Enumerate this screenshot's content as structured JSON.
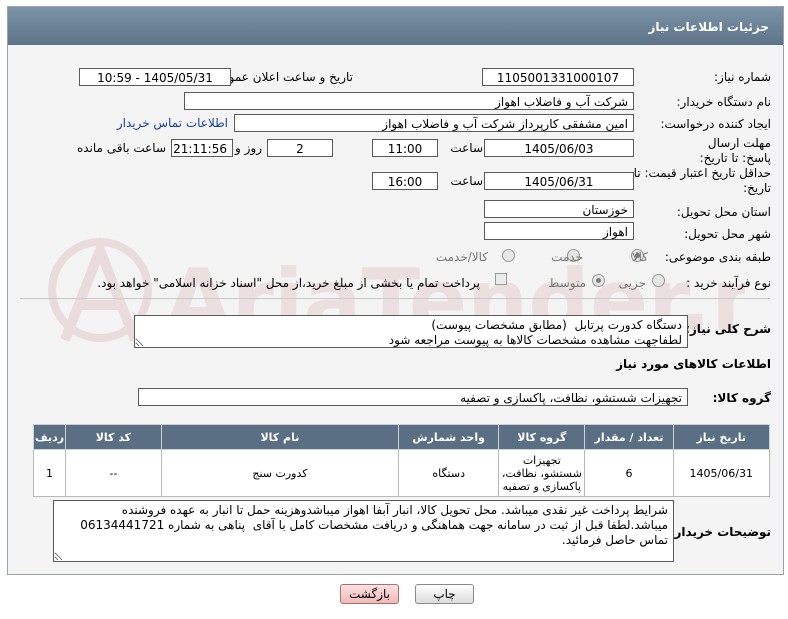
{
  "header": {
    "title": "جزئیات اطلاعات نیاز"
  },
  "fields": {
    "need_number_label": "شماره نیاز:",
    "need_number": "1105001331000107",
    "announce_label": "تاریخ و ساعت اعلان عمومی:",
    "announce_value": "1405/05/31 - 10:59",
    "buyer_org_label": "نام دستگاه خریدار:",
    "buyer_org": "شرکت آب و فاضلاب اهواز",
    "creator_label": "ایجاد کننده درخواست:",
    "creator": "امین مشفقی کارپرداز شرکت آب و فاضلاب اهواز",
    "contact_link": "اطلاعات تماس خریدار",
    "deadline_label": "مهلت ارسال پاسخ: تا تاریخ:",
    "deadline_date": "1405/06/03",
    "time_label": "ساعت",
    "deadline_time": "11:00",
    "days_value": "2",
    "days_label": "روز و",
    "remaining_time": "21:11:56",
    "remaining_label": "ساعت باقی مانده",
    "validity_label": "حداقل تاریخ اعتبار قیمت: تا تاریخ:",
    "validity_date": "1405/06/31",
    "validity_time": "16:00",
    "province_label": "استان محل تحویل:",
    "province": "خوزستان",
    "city_label": "شهر محل تحویل:",
    "city": "اهواز",
    "category_label": "طبقه بندی موضوعی:",
    "category_options": [
      "کالا",
      "خدمت",
      "کالا/خدمت"
    ],
    "process_label": "نوع فرآیند خرید :",
    "process_options": [
      "جزیی",
      "متوسط"
    ],
    "payment_note": "پرداخت تمام یا بخشی از مبلغ خرید،از محل \"اسناد خزانه اسلامی\" خواهد بود."
  },
  "description": {
    "label": "شرح کلی نیاز:",
    "text": "دستگاه کدورت پرتابل  (مطابق مشخصات پیوست)\nلطفاجهت مشاهده مشخصات کالاها به پیوست مراجعه شود"
  },
  "goods": {
    "section_title": "اطلاعات کالاهای مورد نیاز",
    "group_label": "گروه کالا:",
    "group_value": "تجهیزات شستشو، نظافت، پاکسازی و تصفیه",
    "columns": [
      "ردیف",
      "کد کالا",
      "نام کالا",
      "واحد شمارش",
      "گروه کالا",
      "تعداد / مقدار",
      "تاریخ نیاز"
    ],
    "rows": [
      {
        "row": "1",
        "code": "--",
        "name": "کدورت سنج",
        "unit": "دستگاه",
        "group": "تجهیزات شستشو، نظافت، پاکسازی و تصفیه",
        "qty": "6",
        "date": "1405/06/31"
      }
    ]
  },
  "buyer_notes": {
    "label": "توضیحات خریدار:",
    "text": "شرایط پرداخت غیر نقدی میباشد. محل تحویل کالا، انبار آبفا اهواز میباشدوهزینه حمل تا انبار به عهده فروشنده میباشد.لطفا قبل از ثبت در سامانه جهت هماهنگی و دریافت مشخصات کامل با آقای  پناهی به شماره 06134441721  تماس حاصل فرمائید."
  },
  "buttons": {
    "print": "چاپ",
    "back": "بازگشت"
  },
  "colors": {
    "header_bg": "#6b8196",
    "table_header_bg": "#5a6e84",
    "link": "#1a3e9a"
  }
}
